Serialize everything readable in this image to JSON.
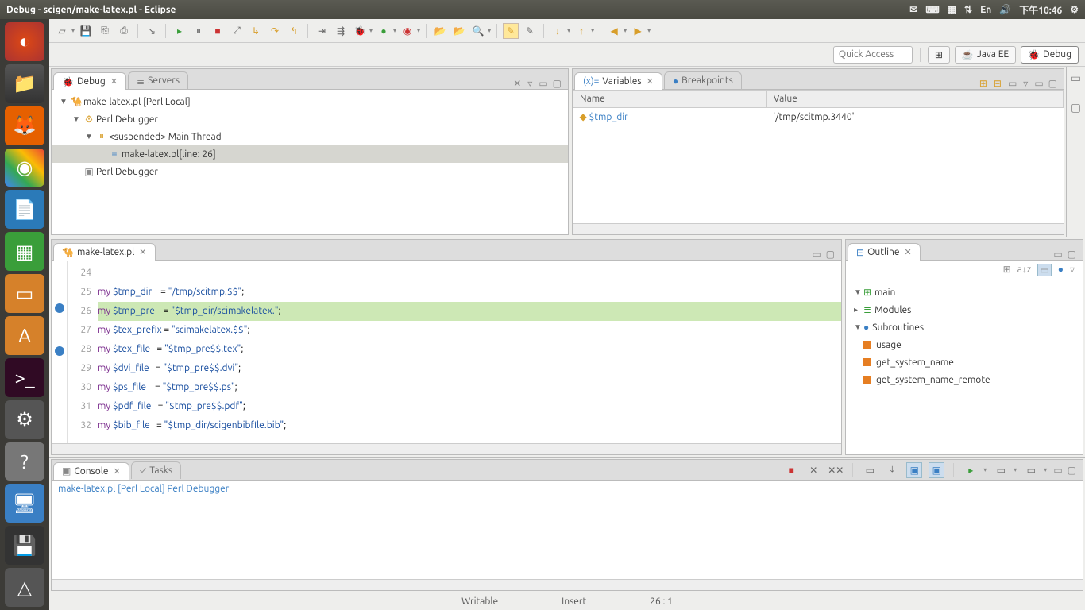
{
  "titlebar": {
    "title": "Debug - scigen/make-latex.pl - Eclipse",
    "lang": "En",
    "time": "下午10:46"
  },
  "launcher": [
    "◐",
    "📁",
    "🦊",
    "⬤",
    "📄",
    "📊",
    "📽",
    "🛍",
    "▣",
    "⚙",
    "?",
    "🖥",
    "💾",
    "△"
  ],
  "topright": {
    "quick": "Quick Access",
    "p1": "Java EE",
    "p2": "Debug"
  },
  "debug": {
    "tab": "Debug",
    "servers": "Servers",
    "items": [
      "make-latex.pl [Perl Local]",
      "Perl Debugger",
      "<suspended> Main Thread",
      "make-latex.pl[line: 26]",
      "Perl Debugger"
    ]
  },
  "vars": {
    "tab": "Variables",
    "bp": "Breakpoints",
    "hname": "Name",
    "hval": "Value",
    "r0n": "$tmp_dir",
    "r0v": "'/tmp/scitmp.3440'"
  },
  "editor": {
    "tab": "make-latex.pl",
    "lines": [
      {
        "n": 24,
        "txt": ""
      },
      {
        "n": 25,
        "kw": "my",
        "var": "$tmp_dir",
        "rest": "    = \"/tmp/scitmp.$$\";"
      },
      {
        "n": 26,
        "kw": "my",
        "var": "$tmp_pre",
        "rest": "    = \"$tmp_dir/scimakelatex.\";",
        "hl": true,
        "bp": true
      },
      {
        "n": 27,
        "kw": "my",
        "var": "$tex_prefix",
        "rest": " = \"scimakelatex.$$\";"
      },
      {
        "n": 28,
        "kw": "my",
        "var": "$tex_file",
        "rest": "   = \"$tmp_pre$$.tex\";",
        "bp": true
      },
      {
        "n": 29,
        "kw": "my",
        "var": "$dvi_file",
        "rest": "   = \"$tmp_pre$$.dvi\";"
      },
      {
        "n": 30,
        "kw": "my",
        "var": "$ps_file",
        "rest": "    = \"$tmp_pre$$.ps\";"
      },
      {
        "n": 31,
        "kw": "my",
        "var": "$pdf_file",
        "rest": "   = \"$tmp_pre$$.pdf\";"
      },
      {
        "n": 32,
        "kw": "my",
        "var": "$bib_file",
        "rest": "   = \"$tmp_dir/scigenbibfile.bib\";"
      }
    ]
  },
  "outline": {
    "tab": "Outline",
    "root": "main",
    "mods": "Modules",
    "subs": "Subroutines",
    "items": [
      "usage",
      "get_system_name",
      "get_system_name_remote"
    ]
  },
  "console": {
    "tab": "Console",
    "tasks": "Tasks",
    "text": "make-latex.pl [Perl Local] Perl Debugger"
  },
  "status": {
    "writable": "Writable",
    "insert": "Insert",
    "pos": "26 : 1"
  }
}
